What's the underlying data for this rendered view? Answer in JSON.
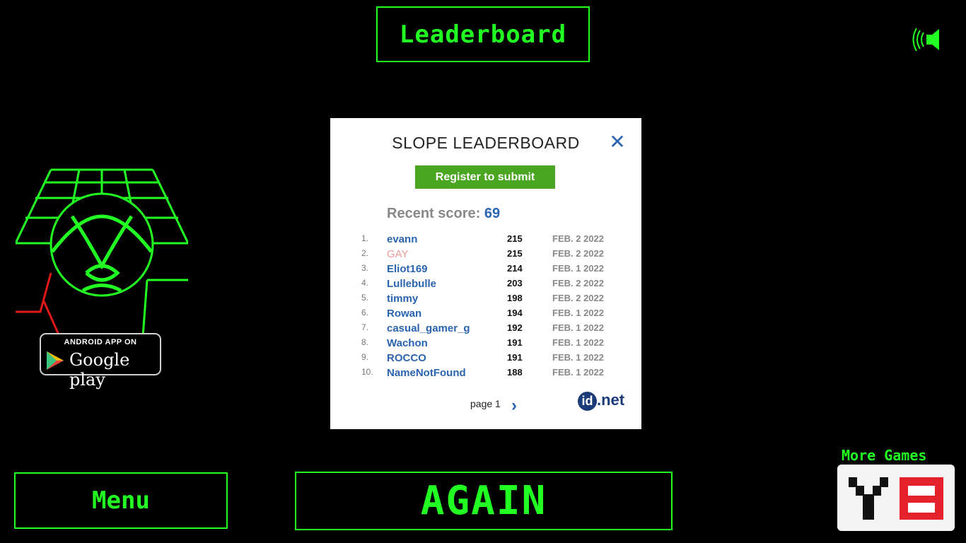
{
  "header": {
    "title": "Leaderboard"
  },
  "icons": {
    "sound": "speaker-on-icon",
    "close": "close-icon",
    "next": "chevron-right-icon",
    "play_store": "google-play-icon"
  },
  "promo": {
    "badge_small": "ANDROID APP ON",
    "badge_big": "Google play"
  },
  "leaderboard": {
    "title": "SLOPE LEADERBOARD",
    "register_label": "Register to submit",
    "recent_label": "Recent score:",
    "recent_value": "69",
    "rows": [
      {
        "rank": "1.",
        "name": "evann",
        "score": "215",
        "date": "FEB. 2 2022"
      },
      {
        "rank": "2.",
        "name": "GAY",
        "score": "215",
        "date": "FEB. 2 2022"
      },
      {
        "rank": "3.",
        "name": "Eliot169",
        "score": "214",
        "date": "FEB. 1 2022"
      },
      {
        "rank": "4.",
        "name": "Lullebulle",
        "score": "203",
        "date": "FEB. 2 2022"
      },
      {
        "rank": "5.",
        "name": "timmy",
        "score": "198",
        "date": "FEB. 2 2022"
      },
      {
        "rank": "6.",
        "name": "Rowan",
        "score": "194",
        "date": "FEB. 1 2022"
      },
      {
        "rank": "7.",
        "name": "casual_gamer_g",
        "score": "192",
        "date": "FEB. 1 2022"
      },
      {
        "rank": "8.",
        "name": "Wachon",
        "score": "191",
        "date": "FEB. 1 2022"
      },
      {
        "rank": "9.",
        "name": "ROCCO",
        "score": "191",
        "date": "FEB. 1 2022"
      },
      {
        "rank": "10.",
        "name": "NameNotFound",
        "score": "188",
        "date": "FEB. 1 2022"
      }
    ],
    "page_label": "page 1",
    "brand": ".net",
    "brand_id": "id"
  },
  "buttons": {
    "menu": "Menu",
    "again": "AGAIN",
    "more_games": "More Games"
  },
  "colors": {
    "neon_green": "#22ff22",
    "link_blue": "#2a64b0",
    "register_green": "#4aa520"
  }
}
